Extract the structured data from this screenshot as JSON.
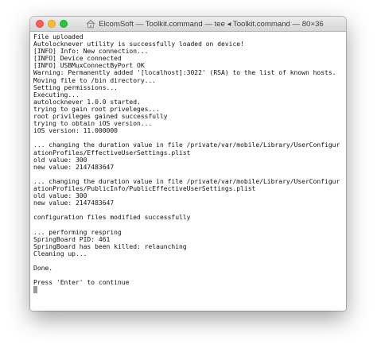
{
  "window": {
    "title": "ElcomSoft — Toolkit.command — tee ◂ Toolkit.command — 80×36",
    "title_icon": "home-folder-icon",
    "buttons": {
      "close": "close-icon",
      "minimize": "minimize-icon",
      "zoom": "zoom-icon"
    }
  },
  "terminal": {
    "lines": [
      "File uploaded",
      "Autolocknever utility is successfully loaded on device!",
      "[INFO] Info: New connection...",
      "[INFO] Device connected",
      "[INFO] USBMuxConnectByPort OK",
      "Warning: Permanently added '[localhost]:3022' (RSA) to the list of known hosts.",
      "Moving file to /bin directory...",
      "Setting permissions...",
      "Executing...",
      "autolocknever 1.0.0 started.",
      "trying to gain root priveleges...",
      "root privileges gained successfully",
      "trying to obtain iOS version...",
      "iOS version: 11.000000",
      "",
      "... changing the duration value in file /private/var/mobile/Library/UserConfigur",
      "ationProfiles/EffectiveUserSettings.plist",
      "old value: 300",
      "new value: 2147483647",
      "",
      "... changing the duration value in file /private/var/mobile/Library/UserConfigur",
      "ationProfiles/PublicInfo/PublicEffectiveUserSettings.plist",
      "old value: 300",
      "new value: 2147483647",
      "",
      "configuration files modified successfully",
      "",
      "... performing respring",
      "SpringBoard PID: 461",
      "SpringBoard has been killed: relaunching",
      "Cleaning up...",
      "",
      "Done.",
      "",
      "Press 'Enter' to continue"
    ]
  },
  "colors": {
    "close": "#fc5f57",
    "minimize": "#fdbc2e",
    "zoom": "#28c840",
    "text": "#111111",
    "background": "#ffffff"
  }
}
